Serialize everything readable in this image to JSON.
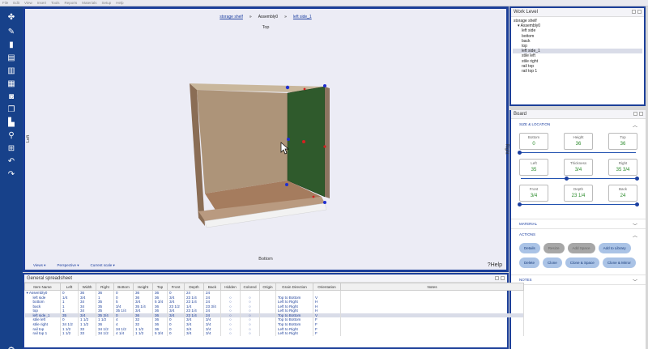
{
  "menu": [
    "File",
    "Edit",
    "View",
    "Insert",
    "Tools",
    "Reports",
    "Materials",
    "Setup",
    "Help"
  ],
  "toolbar": {
    "icons": [
      "assembly-icon",
      "ruler-icon",
      "panel-icon",
      "drawer-icon",
      "shelf-icon",
      "stack-icon",
      "camera-icon",
      "copy-icon",
      "align-icon",
      "search-icon",
      "hierarchy-icon",
      "undo-icon",
      "redo-icon"
    ],
    "glyphs": [
      "✤",
      "✎",
      "▮",
      "▤",
      "▥",
      "▦",
      "◙",
      "❐",
      "▙",
      "⚲",
      "⊞",
      "↶",
      "↷"
    ],
    "settings_glyph": "⚙"
  },
  "viewport": {
    "breadcrumbs": [
      "storage shelf",
      "Assembly0",
      "left side_1"
    ],
    "crumb_sep": "»",
    "top_label": "Top",
    "bottom_label": "Bottom",
    "left_label": "Left",
    "right_label": "Right",
    "footer": [
      "Views ▾",
      "Perspective ▾",
      "Current scale ▾"
    ],
    "help": "?Help"
  },
  "work_level": {
    "title": "Work Level",
    "items": [
      {
        "label": "storage shelf",
        "indent": 0,
        "selected": false
      },
      {
        "label": "▾ Assembly0",
        "indent": 1,
        "selected": false
      },
      {
        "label": "left side",
        "indent": 2,
        "selected": false
      },
      {
        "label": "bottom",
        "indent": 2,
        "selected": false
      },
      {
        "label": "back",
        "indent": 2,
        "selected": false
      },
      {
        "label": "top",
        "indent": 2,
        "selected": false
      },
      {
        "label": "left side_1",
        "indent": 2,
        "selected": true
      },
      {
        "label": "stile left",
        "indent": 2,
        "selected": false
      },
      {
        "label": "stile right",
        "indent": 2,
        "selected": false
      },
      {
        "label": "rail top",
        "indent": 2,
        "selected": false
      },
      {
        "label": "rail top 1",
        "indent": 2,
        "selected": false
      }
    ]
  },
  "board": {
    "title": "Board",
    "size_location": "SIZE & LOCATION",
    "rows": [
      [
        {
          "cap": "Bottom",
          "val": "0"
        },
        {
          "cap": "Height",
          "val": "36"
        },
        {
          "cap": "Top",
          "val": "36"
        }
      ],
      [
        {
          "cap": "Left",
          "val": "35"
        },
        {
          "cap": "Thickness",
          "val": "3/4"
        },
        {
          "cap": "Right",
          "val": "35 3/4"
        }
      ],
      [
        {
          "cap": "Front",
          "val": "3/4"
        },
        {
          "cap": "Depth",
          "val": "23 1/4"
        },
        {
          "cap": "Back",
          "val": "24"
        }
      ]
    ],
    "material": "MATERIAL",
    "actions": "ACTIONS",
    "buttons": [
      {
        "label": "Details",
        "enabled": true
      },
      {
        "label": "Resize",
        "enabled": false
      },
      {
        "label": "Add Space",
        "enabled": false
      },
      {
        "label": "Add to Library",
        "enabled": true
      },
      {
        "label": "Delete",
        "enabled": true
      },
      {
        "label": "Clone",
        "enabled": true
      },
      {
        "label": "Clone & Space",
        "enabled": true
      },
      {
        "label": "Clone & Mirror",
        "enabled": true
      }
    ],
    "notes": "NOTES"
  },
  "sheet": {
    "title": "General spreadsheet",
    "columns": [
      "Item Name",
      "Left",
      "Width",
      "Right",
      "Bottom",
      "Height",
      "Top",
      "Front",
      "Depth",
      "Back",
      "Hidden",
      "Colored",
      "Origin",
      "Grain Direction",
      "Orientation",
      "Notes"
    ],
    "rows": [
      [
        "▾ Assembly0",
        "0",
        "36",
        "36",
        "0",
        "36",
        "36",
        "0",
        "24",
        "24",
        "",
        "",
        "",
        "",
        "",
        ""
      ],
      [
        "left side",
        "1/4",
        "3/4",
        "1",
        "0",
        "36",
        "36",
        "3/4",
        "23 1/4",
        "24",
        "○",
        "○",
        "",
        "Top to Bottom",
        "V",
        ""
      ],
      [
        "bottom",
        "1",
        "34",
        "35",
        "5",
        "3/4",
        "5 3/4",
        "3/4",
        "23 1/4",
        "24",
        "○",
        "○",
        "",
        "Left to Right",
        "H",
        ""
      ],
      [
        "back",
        "1",
        "34",
        "35",
        "3/4",
        "35 1/4",
        "36",
        "23 1/2",
        "1/4",
        "23 3/4",
        "○",
        "○",
        "",
        "Left to Right",
        "H",
        ""
      ],
      [
        "top",
        "1",
        "34",
        "35",
        "35 1/4",
        "3/4",
        "36",
        "3/4",
        "23 1/4",
        "24",
        "○",
        "○",
        "",
        "Left to Right",
        "H",
        ""
      ],
      [
        "left side_1",
        "35",
        "3/4",
        "35 3/4",
        "0",
        "36",
        "36",
        "3/4",
        "23 1/4",
        "24",
        "○",
        "○",
        "",
        "Top to Bottom",
        "V",
        ""
      ],
      [
        "stile left",
        "0",
        "1 1/2",
        "1 1/2",
        "4",
        "32",
        "36",
        "0",
        "3/4",
        "3/4",
        "○",
        "○",
        "",
        "Top to Bottom",
        "F",
        ""
      ],
      [
        "stile right",
        "34 1/2",
        "1 1/2",
        "36",
        "4",
        "32",
        "36",
        "0",
        "3/4",
        "3/4",
        "○",
        "○",
        "",
        "Top to Bottom",
        "F",
        ""
      ],
      [
        "rail top",
        "1 1/2",
        "33",
        "34 1/2",
        "34 1/2",
        "1 1/2",
        "36",
        "0",
        "3/4",
        "3/4",
        "○",
        "○",
        "",
        "Left to Right",
        "F",
        ""
      ],
      [
        "rail top 1",
        "1 1/2",
        "33",
        "34 1/2",
        "4 1/4",
        "1 1/2",
        "5 3/4",
        "0",
        "3/4",
        "3/4",
        "○",
        "○",
        "",
        "Left to Right",
        "F",
        ""
      ]
    ],
    "selected_row": 5
  },
  "colors": {
    "brand": "#17418a",
    "frame": "#1c3f99",
    "field_value": "#2a8a2a",
    "selection": "#d9dce8"
  }
}
